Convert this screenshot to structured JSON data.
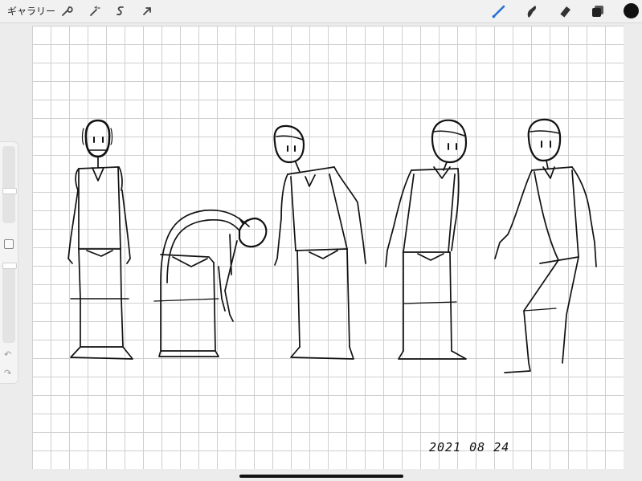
{
  "topbar": {
    "gallery_label": "ギャラリー",
    "left_tools": [
      "wrench-icon",
      "magic-wand-icon",
      "selection-icon",
      "transform-arrow-icon"
    ],
    "right_tools": [
      "brush-icon",
      "smudge-icon",
      "eraser-icon",
      "layers-icon"
    ],
    "accent_color": "#2a6fd6",
    "current_color": "#111111"
  },
  "sidebar": {
    "brush_size_level": 0.55,
    "opacity_level": 0.02,
    "undo_icon": "undo-icon",
    "redo_icon": "redo-icon"
  },
  "canvas": {
    "grid": true,
    "date_text": "2021 08 24"
  }
}
